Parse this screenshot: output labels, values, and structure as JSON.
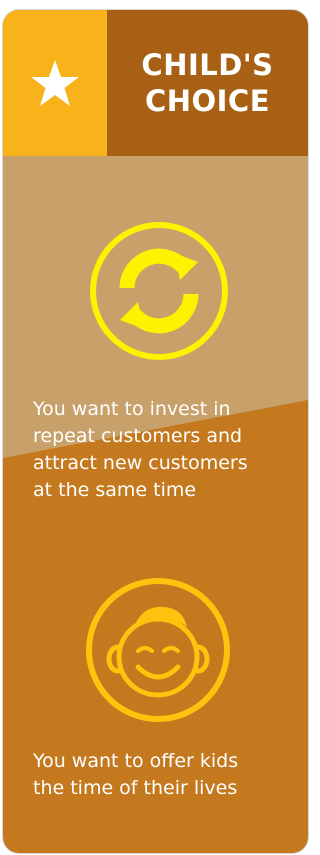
{
  "card": {
    "title_line1": "CHILD'S",
    "title_line2": "CHOICE",
    "header_icon": "star-icon",
    "features": [
      {
        "icon": "refresh-icon",
        "text_lines": [
          "You want to invest in",
          "repeat customers and",
          "attract new customers",
          "at the same time"
        ]
      },
      {
        "icon": "child-face-icon",
        "text_lines": [
          "You want to offer kids",
          "the time of their lives"
        ]
      }
    ]
  },
  "colors": {
    "star_bg": "#f8b31a",
    "title_bg": "#a86114",
    "upper_bg": "#c8a06a",
    "lower_bg": "#c4791e",
    "refresh_icon": "#fff200",
    "face_icon": "#ffc20e"
  }
}
